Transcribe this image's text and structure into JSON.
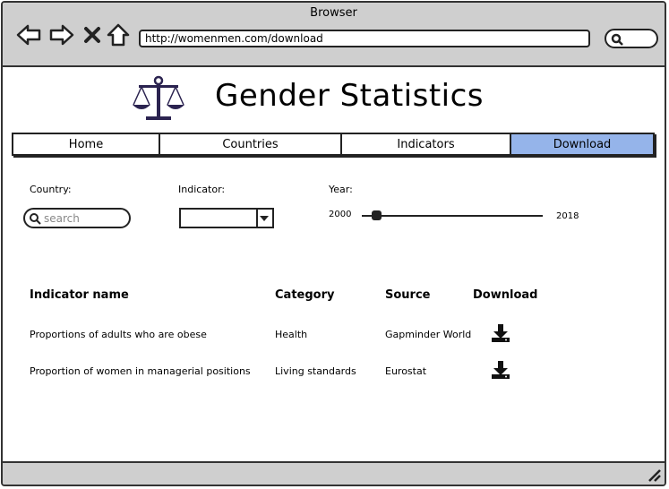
{
  "browser": {
    "title": "Browser",
    "url": "http://womenmen.com/download"
  },
  "page": {
    "heading": "Gender Statistics"
  },
  "nav": {
    "tabs": [
      {
        "label": "Home"
      },
      {
        "label": "Countries"
      },
      {
        "label": "Indicators"
      },
      {
        "label": "Download",
        "active": true
      }
    ]
  },
  "filters": {
    "country_label": "Country:",
    "search_placeholder": "search",
    "indicator_label": "Indicator:",
    "indicator_value": "",
    "year_label": "Year:",
    "year_min": "2000",
    "year_max": "2018"
  },
  "table": {
    "headers": [
      "Indicator name",
      "Category",
      "Source",
      "Download"
    ],
    "rows": [
      {
        "name": "Proportions of adults who are obese",
        "category": "Health",
        "source": "Gapminder World"
      },
      {
        "name": "Proportion of women in managerial positions",
        "category": "Living standards",
        "source": "Eurostat"
      }
    ]
  },
  "colors": {
    "active_tab": "#95b4ea",
    "chrome": "#cfcfcf"
  }
}
